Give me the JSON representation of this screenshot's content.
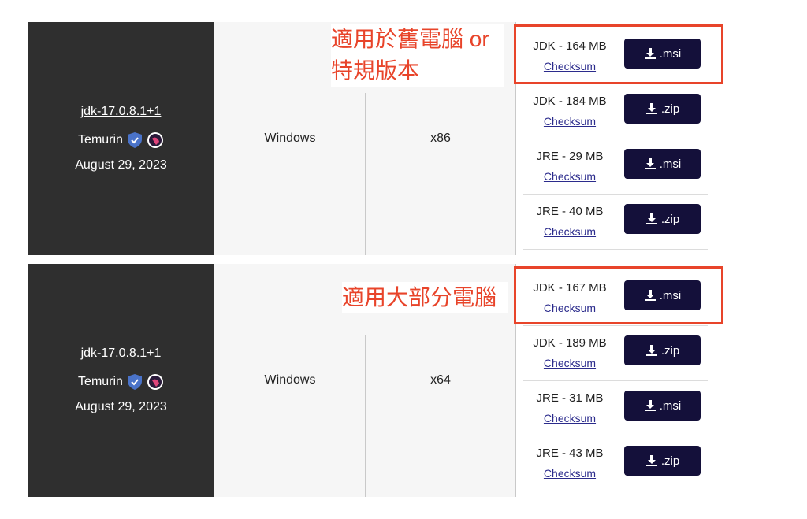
{
  "annotations": {
    "note1_line1": "適用於舊電腦 or",
    "note1_line2": "特規版本",
    "note2": "適用大部分電腦"
  },
  "releases": [
    {
      "version": "jdk-17.0.8.1+1",
      "vendor": "Temurin",
      "date": "August 29, 2023",
      "os": "Windows",
      "arch": "x86",
      "packages": [
        {
          "label": "JDK - 164 MB",
          "checksum": "Checksum",
          "button": ".msi"
        },
        {
          "label": "JDK - 184 MB",
          "checksum": "Checksum",
          "button": ".zip"
        },
        {
          "label": "JRE - 29 MB",
          "checksum": "Checksum",
          "button": ".msi"
        },
        {
          "label": "JRE - 40 MB",
          "checksum": "Checksum",
          "button": ".zip"
        }
      ]
    },
    {
      "version": "jdk-17.0.8.1+1",
      "vendor": "Temurin",
      "date": "August 29, 2023",
      "os": "Windows",
      "arch": "x64",
      "packages": [
        {
          "label": "JDK - 167 MB",
          "checksum": "Checksum",
          "button": ".msi"
        },
        {
          "label": "JDK - 189 MB",
          "checksum": "Checksum",
          "button": ".zip"
        },
        {
          "label": "JRE - 31 MB",
          "checksum": "Checksum",
          "button": ".msi"
        },
        {
          "label": "JRE - 43 MB",
          "checksum": "Checksum",
          "button": ".zip"
        }
      ]
    }
  ],
  "colors": {
    "release_bg": "#2f2f2f",
    "button_bg": "#14103a",
    "annotation": "#e8442a",
    "link": "#2b2b8c"
  }
}
